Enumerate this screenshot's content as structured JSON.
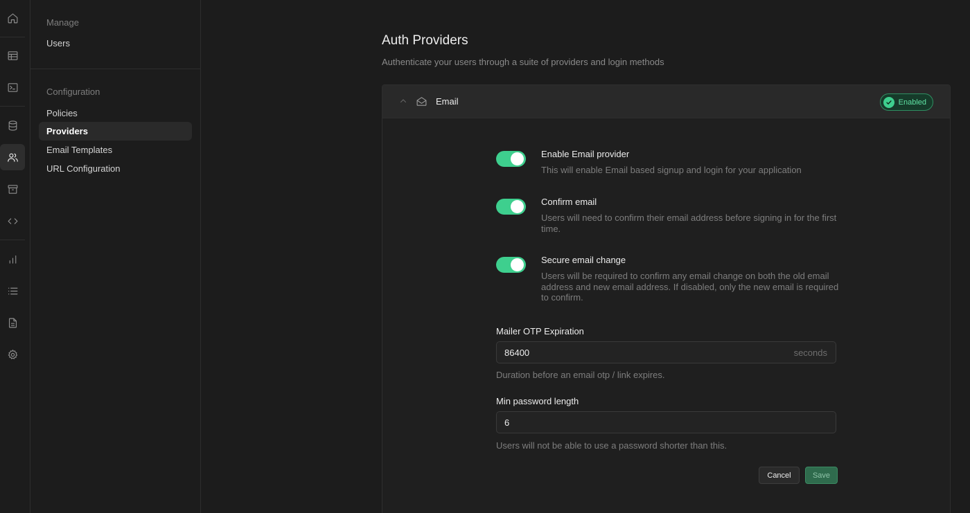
{
  "rail": {
    "icons": [
      "home-icon",
      "table-icon",
      "terminal-icon",
      "database-icon",
      "users-icon",
      "archive-icon",
      "code-icon",
      "bar-chart-icon",
      "list-icon",
      "document-icon",
      "gear-icon"
    ]
  },
  "sidebar": {
    "manage_title": "Manage",
    "manage_items": [
      {
        "label": "Users"
      }
    ],
    "config_title": "Configuration",
    "config_items": [
      {
        "label": "Policies"
      },
      {
        "label": "Providers"
      },
      {
        "label": "Email Templates"
      },
      {
        "label": "URL Configuration"
      }
    ]
  },
  "main": {
    "title": "Auth Providers",
    "subtitle": "Authenticate your users through a suite of providers and login methods",
    "provider": {
      "name": "Email",
      "status": "Enabled",
      "toggles": [
        {
          "title": "Enable Email provider",
          "description": "This will enable Email based signup and login for your application",
          "on": true
        },
        {
          "title": "Confirm email",
          "description": "Users will need to confirm their email address before signing in for the first time.",
          "on": true
        },
        {
          "title": "Secure email change",
          "description": "Users will be required to confirm any email change on both the old email address and new email address. If disabled, only the new email is required to confirm.",
          "on": true
        }
      ],
      "otp": {
        "label": "Mailer OTP Expiration",
        "value": "86400",
        "suffix": "seconds",
        "help": "Duration before an email otp / link expires."
      },
      "password": {
        "label": "Min password length",
        "value": "6",
        "help": "Users will not be able to use a password shorter than this."
      },
      "cancel_label": "Cancel",
      "save_label": "Save"
    }
  },
  "colors": {
    "accent": "#3ecf8e",
    "background": "#1c1c1c",
    "panel": "#1f1f1f"
  }
}
